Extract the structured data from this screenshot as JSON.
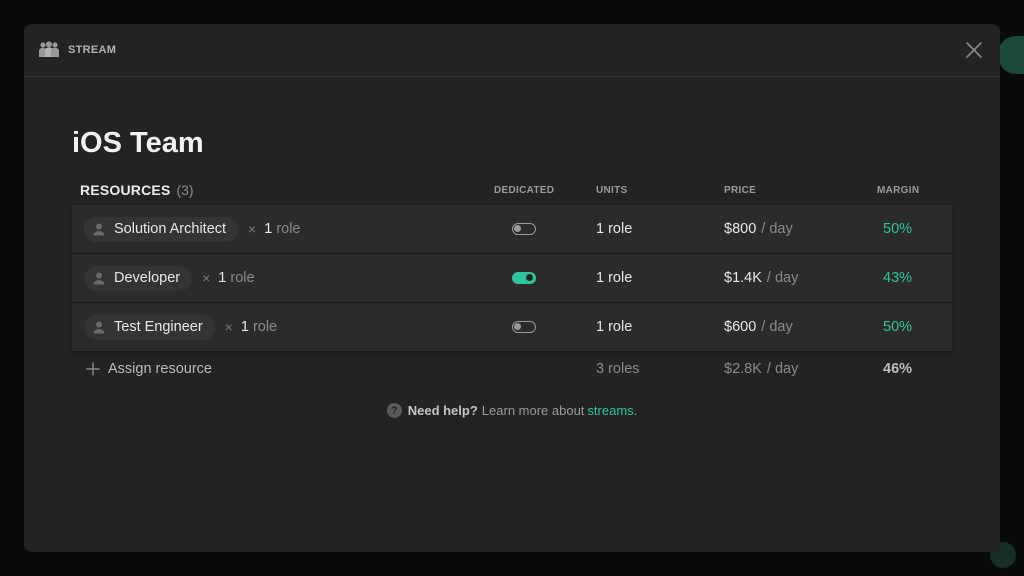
{
  "header": {
    "label": "STREAM",
    "icon": "team-icon",
    "close_icon": "close-icon"
  },
  "team_title": "iOS Team",
  "table": {
    "resources_label": "RESOURCES",
    "resources_count": "(3)",
    "columns": {
      "dedicated": "DEDICATED",
      "units": "UNITS",
      "price": "PRICE",
      "margin": "MARGIN"
    },
    "rows": [
      {
        "role": "Solution Architect",
        "times": "×",
        "qty": "1",
        "qty_unit": "role",
        "dedicated": false,
        "units": "1 role",
        "price": "$800",
        "per": "/ day",
        "margin": "50%"
      },
      {
        "role": "Developer",
        "times": "×",
        "qty": "1",
        "qty_unit": "role",
        "dedicated": true,
        "units": "1 role",
        "price": "$1.4K",
        "per": "/ day",
        "margin": "43%"
      },
      {
        "role": "Test Engineer",
        "times": "×",
        "qty": "1",
        "qty_unit": "role",
        "dedicated": false,
        "units": "1 role",
        "price": "$600",
        "per": "/ day",
        "margin": "50%"
      }
    ],
    "footer": {
      "assign_label": "Assign resource",
      "units": "3 roles",
      "price": "$2.8K",
      "per": "/ day",
      "margin": "46%"
    }
  },
  "help": {
    "q": "?",
    "bold": "Need help?",
    "text": "Learn more about",
    "link": "streams",
    "end": "."
  },
  "colors": {
    "accent": "#2dc59a",
    "modal_bg": "#232323",
    "row_bg": "#2b2b2b"
  }
}
